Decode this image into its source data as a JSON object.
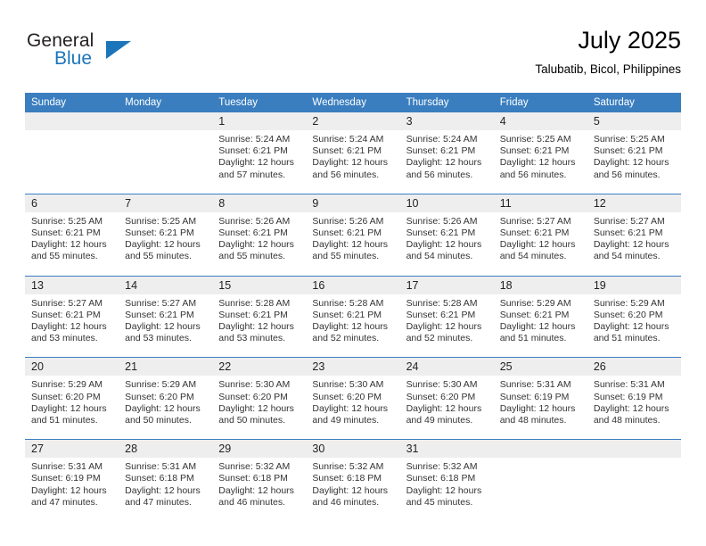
{
  "logo": {
    "word_top": "General",
    "word_bottom": "Blue",
    "triangle_icon": "triangle-icon",
    "brand_color": "#1b75bb"
  },
  "header": {
    "title": "July 2025",
    "subtitle": "Talubatib, Bicol, Philippines"
  },
  "theme": {
    "header_blue": "#3a7ebf",
    "daynum_gray": "#eeeeee",
    "text_dark": "#333333"
  },
  "calendar": {
    "weekday_headers": [
      "Sunday",
      "Monday",
      "Tuesday",
      "Wednesday",
      "Thursday",
      "Friday",
      "Saturday"
    ],
    "weeks": [
      {
        "days": [
          {
            "num": "",
            "sunrise": "",
            "sunset": "",
            "daylight_line1": "",
            "daylight_line2": ""
          },
          {
            "num": "",
            "sunrise": "",
            "sunset": "",
            "daylight_line1": "",
            "daylight_line2": ""
          },
          {
            "num": "1",
            "sunrise": "Sunrise: 5:24 AM",
            "sunset": "Sunset: 6:21 PM",
            "daylight_line1": "Daylight: 12 hours",
            "daylight_line2": "and 57 minutes."
          },
          {
            "num": "2",
            "sunrise": "Sunrise: 5:24 AM",
            "sunset": "Sunset: 6:21 PM",
            "daylight_line1": "Daylight: 12 hours",
            "daylight_line2": "and 56 minutes."
          },
          {
            "num": "3",
            "sunrise": "Sunrise: 5:24 AM",
            "sunset": "Sunset: 6:21 PM",
            "daylight_line1": "Daylight: 12 hours",
            "daylight_line2": "and 56 minutes."
          },
          {
            "num": "4",
            "sunrise": "Sunrise: 5:25 AM",
            "sunset": "Sunset: 6:21 PM",
            "daylight_line1": "Daylight: 12 hours",
            "daylight_line2": "and 56 minutes."
          },
          {
            "num": "5",
            "sunrise": "Sunrise: 5:25 AM",
            "sunset": "Sunset: 6:21 PM",
            "daylight_line1": "Daylight: 12 hours",
            "daylight_line2": "and 56 minutes."
          }
        ]
      },
      {
        "days": [
          {
            "num": "6",
            "sunrise": "Sunrise: 5:25 AM",
            "sunset": "Sunset: 6:21 PM",
            "daylight_line1": "Daylight: 12 hours",
            "daylight_line2": "and 55 minutes."
          },
          {
            "num": "7",
            "sunrise": "Sunrise: 5:25 AM",
            "sunset": "Sunset: 6:21 PM",
            "daylight_line1": "Daylight: 12 hours",
            "daylight_line2": "and 55 minutes."
          },
          {
            "num": "8",
            "sunrise": "Sunrise: 5:26 AM",
            "sunset": "Sunset: 6:21 PM",
            "daylight_line1": "Daylight: 12 hours",
            "daylight_line2": "and 55 minutes."
          },
          {
            "num": "9",
            "sunrise": "Sunrise: 5:26 AM",
            "sunset": "Sunset: 6:21 PM",
            "daylight_line1": "Daylight: 12 hours",
            "daylight_line2": "and 55 minutes."
          },
          {
            "num": "10",
            "sunrise": "Sunrise: 5:26 AM",
            "sunset": "Sunset: 6:21 PM",
            "daylight_line1": "Daylight: 12 hours",
            "daylight_line2": "and 54 minutes."
          },
          {
            "num": "11",
            "sunrise": "Sunrise: 5:27 AM",
            "sunset": "Sunset: 6:21 PM",
            "daylight_line1": "Daylight: 12 hours",
            "daylight_line2": "and 54 minutes."
          },
          {
            "num": "12",
            "sunrise": "Sunrise: 5:27 AM",
            "sunset": "Sunset: 6:21 PM",
            "daylight_line1": "Daylight: 12 hours",
            "daylight_line2": "and 54 minutes."
          }
        ]
      },
      {
        "days": [
          {
            "num": "13",
            "sunrise": "Sunrise: 5:27 AM",
            "sunset": "Sunset: 6:21 PM",
            "daylight_line1": "Daylight: 12 hours",
            "daylight_line2": "and 53 minutes."
          },
          {
            "num": "14",
            "sunrise": "Sunrise: 5:27 AM",
            "sunset": "Sunset: 6:21 PM",
            "daylight_line1": "Daylight: 12 hours",
            "daylight_line2": "and 53 minutes."
          },
          {
            "num": "15",
            "sunrise": "Sunrise: 5:28 AM",
            "sunset": "Sunset: 6:21 PM",
            "daylight_line1": "Daylight: 12 hours",
            "daylight_line2": "and 53 minutes."
          },
          {
            "num": "16",
            "sunrise": "Sunrise: 5:28 AM",
            "sunset": "Sunset: 6:21 PM",
            "daylight_line1": "Daylight: 12 hours",
            "daylight_line2": "and 52 minutes."
          },
          {
            "num": "17",
            "sunrise": "Sunrise: 5:28 AM",
            "sunset": "Sunset: 6:21 PM",
            "daylight_line1": "Daylight: 12 hours",
            "daylight_line2": "and 52 minutes."
          },
          {
            "num": "18",
            "sunrise": "Sunrise: 5:29 AM",
            "sunset": "Sunset: 6:21 PM",
            "daylight_line1": "Daylight: 12 hours",
            "daylight_line2": "and 51 minutes."
          },
          {
            "num": "19",
            "sunrise": "Sunrise: 5:29 AM",
            "sunset": "Sunset: 6:20 PM",
            "daylight_line1": "Daylight: 12 hours",
            "daylight_line2": "and 51 minutes."
          }
        ]
      },
      {
        "days": [
          {
            "num": "20",
            "sunrise": "Sunrise: 5:29 AM",
            "sunset": "Sunset: 6:20 PM",
            "daylight_line1": "Daylight: 12 hours",
            "daylight_line2": "and 51 minutes."
          },
          {
            "num": "21",
            "sunrise": "Sunrise: 5:29 AM",
            "sunset": "Sunset: 6:20 PM",
            "daylight_line1": "Daylight: 12 hours",
            "daylight_line2": "and 50 minutes."
          },
          {
            "num": "22",
            "sunrise": "Sunrise: 5:30 AM",
            "sunset": "Sunset: 6:20 PM",
            "daylight_line1": "Daylight: 12 hours",
            "daylight_line2": "and 50 minutes."
          },
          {
            "num": "23",
            "sunrise": "Sunrise: 5:30 AM",
            "sunset": "Sunset: 6:20 PM",
            "daylight_line1": "Daylight: 12 hours",
            "daylight_line2": "and 49 minutes."
          },
          {
            "num": "24",
            "sunrise": "Sunrise: 5:30 AM",
            "sunset": "Sunset: 6:20 PM",
            "daylight_line1": "Daylight: 12 hours",
            "daylight_line2": "and 49 minutes."
          },
          {
            "num": "25",
            "sunrise": "Sunrise: 5:31 AM",
            "sunset": "Sunset: 6:19 PM",
            "daylight_line1": "Daylight: 12 hours",
            "daylight_line2": "and 48 minutes."
          },
          {
            "num": "26",
            "sunrise": "Sunrise: 5:31 AM",
            "sunset": "Sunset: 6:19 PM",
            "daylight_line1": "Daylight: 12 hours",
            "daylight_line2": "and 48 minutes."
          }
        ]
      },
      {
        "days": [
          {
            "num": "27",
            "sunrise": "Sunrise: 5:31 AM",
            "sunset": "Sunset: 6:19 PM",
            "daylight_line1": "Daylight: 12 hours",
            "daylight_line2": "and 47 minutes."
          },
          {
            "num": "28",
            "sunrise": "Sunrise: 5:31 AM",
            "sunset": "Sunset: 6:18 PM",
            "daylight_line1": "Daylight: 12 hours",
            "daylight_line2": "and 47 minutes."
          },
          {
            "num": "29",
            "sunrise": "Sunrise: 5:32 AM",
            "sunset": "Sunset: 6:18 PM",
            "daylight_line1": "Daylight: 12 hours",
            "daylight_line2": "and 46 minutes."
          },
          {
            "num": "30",
            "sunrise": "Sunrise: 5:32 AM",
            "sunset": "Sunset: 6:18 PM",
            "daylight_line1": "Daylight: 12 hours",
            "daylight_line2": "and 46 minutes."
          },
          {
            "num": "31",
            "sunrise": "Sunrise: 5:32 AM",
            "sunset": "Sunset: 6:18 PM",
            "daylight_line1": "Daylight: 12 hours",
            "daylight_line2": "and 45 minutes."
          },
          {
            "num": "",
            "sunrise": "",
            "sunset": "",
            "daylight_line1": "",
            "daylight_line2": ""
          },
          {
            "num": "",
            "sunrise": "",
            "sunset": "",
            "daylight_line1": "",
            "daylight_line2": ""
          }
        ]
      }
    ]
  }
}
